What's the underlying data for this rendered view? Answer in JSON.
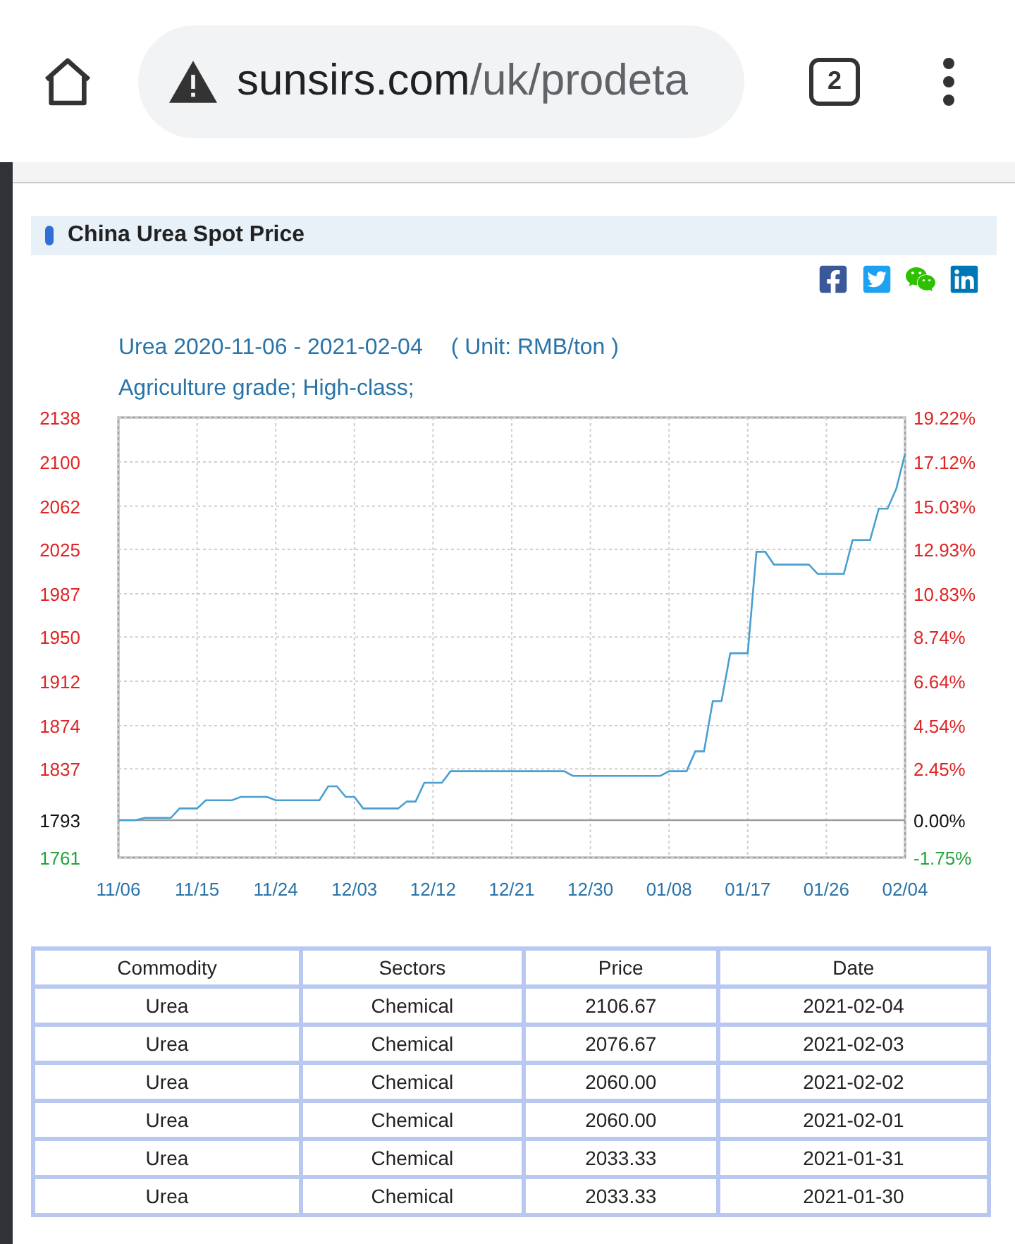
{
  "browser": {
    "url_host": "sunsirs.com",
    "url_path": "/uk/prodeta",
    "tab_count": "2"
  },
  "section": {
    "title": "China Urea Spot Price"
  },
  "chart": {
    "heading": "Urea 2020-11-06 - 2021-02-04",
    "unit": "( Unit: RMB/ton )",
    "subtitle": "Agriculture grade; High-class;",
    "right_axis_labels": [
      {
        "label": "19.22%",
        "color": "#e02424"
      },
      {
        "label": "17.12%",
        "color": "#e02424"
      },
      {
        "label": "15.03%",
        "color": "#e02424"
      },
      {
        "label": "12.93%",
        "color": "#e02424"
      },
      {
        "label": "10.83%",
        "color": "#e02424"
      },
      {
        "label": "8.74%",
        "color": "#e02424"
      },
      {
        "label": "6.64%",
        "color": "#e02424"
      },
      {
        "label": "4.54%",
        "color": "#e02424"
      },
      {
        "label": "2.45%",
        "color": "#e02424"
      },
      {
        "label": "0.00%",
        "color": "#111111"
      },
      {
        "label": "-1.75%",
        "color": "#22a43a"
      }
    ],
    "chart_data": {
      "type": "line",
      "ylim": [
        1761,
        2138
      ],
      "grid": true,
      "ref_lines": [
        {
          "axis": "y",
          "value": 1793
        }
      ],
      "yticks": [
        2138,
        2100,
        2062,
        2025,
        1987,
        1950,
        1912,
        1874,
        1837,
        1793,
        1761
      ],
      "categories": [
        "11/06",
        null,
        null,
        null,
        null,
        null,
        null,
        null,
        null,
        "11/15",
        null,
        null,
        null,
        null,
        null,
        null,
        null,
        null,
        "11/24",
        null,
        null,
        null,
        null,
        null,
        null,
        null,
        null,
        "12/03",
        null,
        null,
        null,
        null,
        null,
        null,
        null,
        null,
        "12/12",
        null,
        null,
        null,
        null,
        null,
        null,
        null,
        null,
        "12/21",
        null,
        null,
        null,
        null,
        null,
        null,
        null,
        null,
        "12/30",
        null,
        null,
        null,
        null,
        null,
        null,
        null,
        null,
        "01/08",
        null,
        null,
        null,
        null,
        null,
        null,
        null,
        null,
        "01/17",
        null,
        null,
        null,
        null,
        null,
        null,
        null,
        null,
        "01/26",
        null,
        null,
        null,
        null,
        null,
        null,
        null,
        null,
        "02/04"
      ],
      "series": [
        {
          "color": "#4a9fd0",
          "values": [
            1793,
            1793,
            1793,
            1795,
            1795,
            1795,
            1795,
            1803,
            1803,
            1803,
            1810,
            1810,
            1810,
            1810,
            1813,
            1813,
            1813,
            1813,
            1810,
            1810,
            1810,
            1810,
            1810,
            1810,
            1822,
            1822,
            1813,
            1813,
            1803,
            1803,
            1803,
            1803,
            1803,
            1809,
            1809,
            1825,
            1825,
            1825,
            1835,
            1835,
            1835,
            1835,
            1835,
            1835,
            1835,
            1835,
            1835,
            1835,
            1835,
            1835,
            1835,
            1835,
            1831,
            1831,
            1831,
            1831,
            1831,
            1831,
            1831,
            1831,
            1831,
            1831,
            1831,
            1835,
            1835,
            1835,
            1852,
            1852,
            1895,
            1895,
            1936,
            1936,
            1936,
            2023,
            2023,
            2012,
            2012,
            2012,
            2012,
            2012,
            2004,
            2004,
            2004,
            2004,
            2033,
            2033,
            2033,
            2060,
            2060,
            2077,
            2107
          ]
        }
      ]
    }
  },
  "table": {
    "columns": [
      "Commodity",
      "Sectors",
      "Price",
      "Date"
    ],
    "rows": [
      [
        "Urea",
        "Chemical",
        "2106.67",
        "2021-02-04"
      ],
      [
        "Urea",
        "Chemical",
        "2076.67",
        "2021-02-03"
      ],
      [
        "Urea",
        "Chemical",
        "2060.00",
        "2021-02-02"
      ],
      [
        "Urea",
        "Chemical",
        "2060.00",
        "2021-02-01"
      ],
      [
        "Urea",
        "Chemical",
        "2033.33",
        "2021-01-31"
      ],
      [
        "Urea",
        "Chemical",
        "2033.33",
        "2021-01-30"
      ]
    ]
  }
}
